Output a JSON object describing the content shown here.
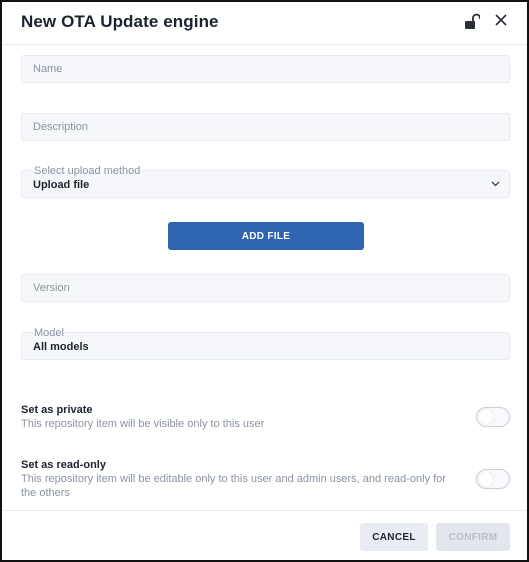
{
  "dialog": {
    "title": "New OTA Update engine",
    "icons": {
      "lock": "lock-open-icon",
      "close": "close-icon"
    }
  },
  "form": {
    "name": {
      "placeholder": "Name",
      "value": ""
    },
    "description": {
      "placeholder": "Description",
      "value": ""
    },
    "upload_method": {
      "label": "Select upload method",
      "value": "Upload file"
    },
    "add_file_label": "ADD FILE",
    "version": {
      "placeholder": "Version",
      "value": ""
    },
    "model": {
      "label": "Model",
      "value": "All models"
    },
    "private": {
      "title": "Set as private",
      "description": "This repository item will be visible only to this user",
      "enabled": false
    },
    "readonly": {
      "title": "Set as read-only",
      "description": "This repository item will be editable only to this user and admin users, and read-only for the others",
      "enabled": false
    }
  },
  "footer": {
    "cancel_label": "CANCEL",
    "confirm_label": "CONFIRM",
    "confirm_disabled": true
  },
  "colors": {
    "primary": "#2f64b1",
    "field_bg": "#f5f7fa",
    "muted_text": "#8a94a3",
    "title_text": "#1b2230"
  }
}
